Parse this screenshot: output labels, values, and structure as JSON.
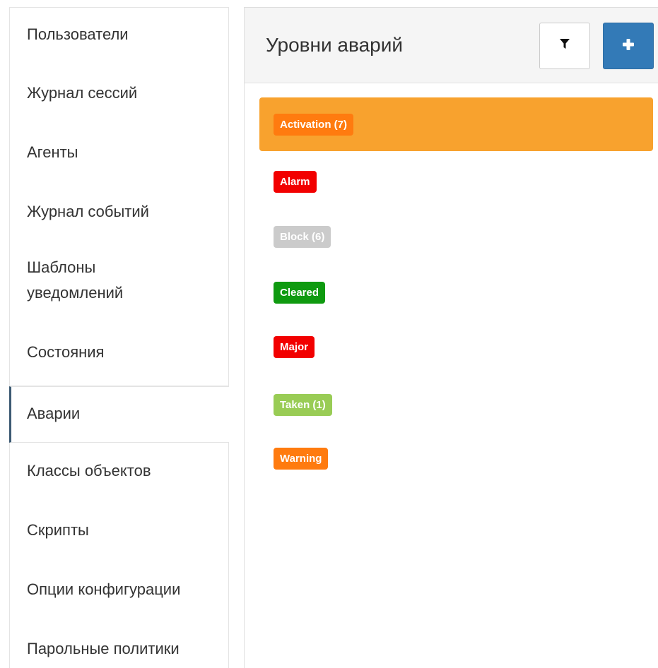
{
  "sidebar": {
    "items": [
      {
        "label": "Пользователи"
      },
      {
        "label": "Журнал сессий"
      },
      {
        "label": "Агенты"
      },
      {
        "label": "Журнал событий"
      },
      {
        "label": "Шаблоны уведомлений"
      },
      {
        "label": "Состояния"
      },
      {
        "label": "Аварии",
        "active": true
      },
      {
        "label": "Классы объектов"
      },
      {
        "label": "Скрипты"
      },
      {
        "label": "Опции конфигурации"
      },
      {
        "label": "Парольные политики"
      }
    ]
  },
  "header": {
    "title": "Уровни аварий",
    "filter_icon": "filter-icon",
    "add_icon": "plus-icon"
  },
  "levels": [
    {
      "label": "Activation (7)",
      "color": "#ff7b0f",
      "selected": true
    },
    {
      "label": "Alarm",
      "color": "#f20000"
    },
    {
      "label": "Block (6)",
      "color": "#cbcbcb"
    },
    {
      "label": "Cleared",
      "color": "#0f9a10"
    },
    {
      "label": "Major",
      "color": "#f20000"
    },
    {
      "label": "Taken (1)",
      "color": "#99cc55"
    },
    {
      "label": "Warning",
      "color": "#ff7b0f"
    }
  ],
  "colors": {
    "selected_row": "#f8a22e",
    "primary_button": "#337ab7",
    "active_sidebar_border": "#3c5a73"
  }
}
